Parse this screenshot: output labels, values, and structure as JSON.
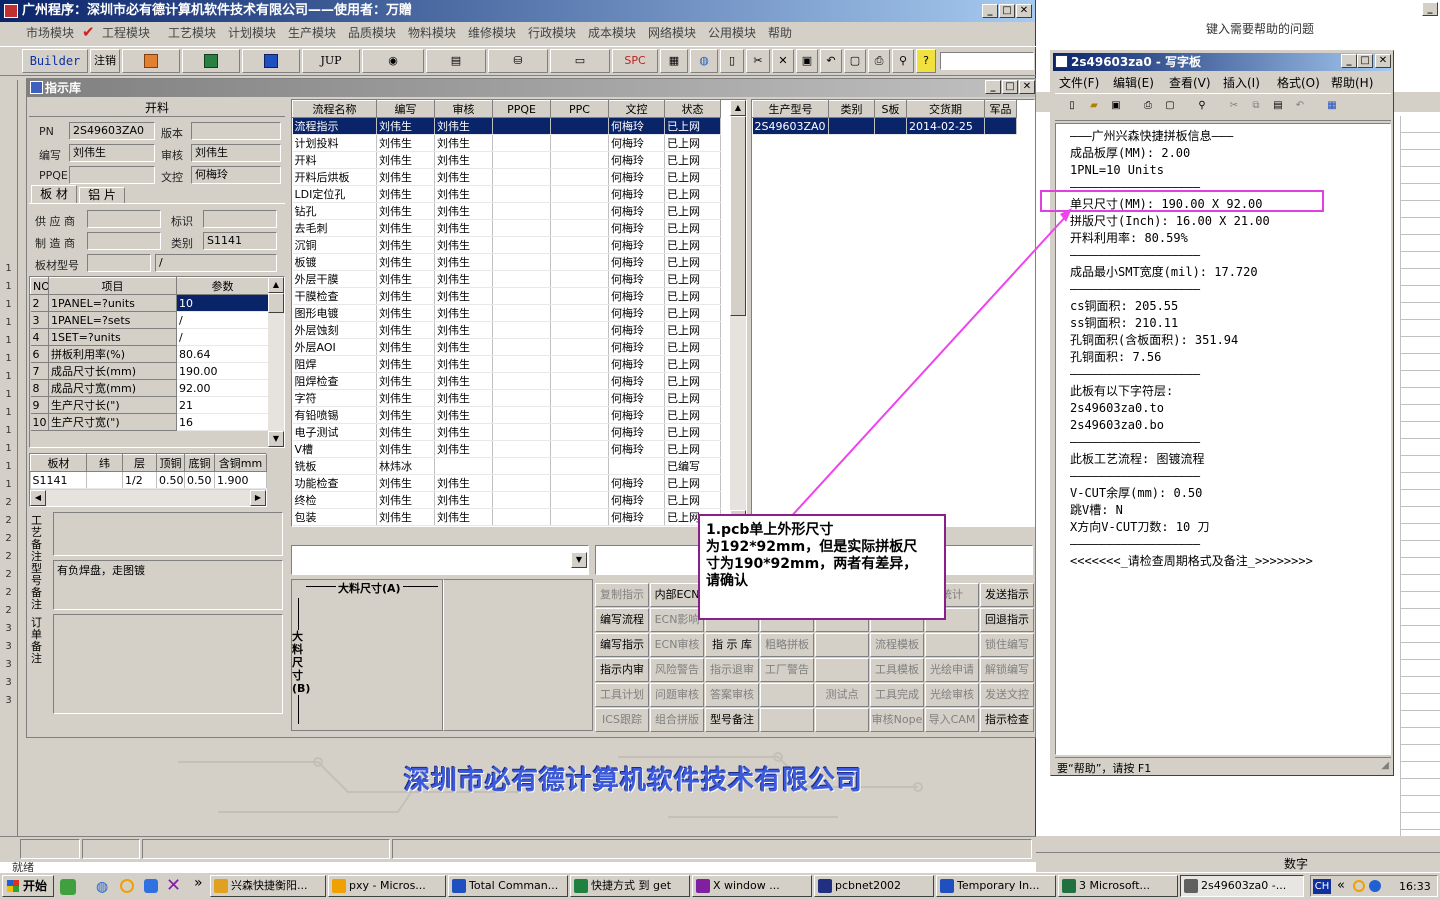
{
  "main_window": {
    "title": "广州程序：深圳市必有德计算机软件技术有限公司——使用者：万贈",
    "menu": [
      "市场模块",
      "工程模块",
      "工艺模块",
      "计划模块",
      "生产模块",
      "品质模块",
      "物料模块",
      "维修模块",
      "行政模块",
      "成本模块",
      "网络模块",
      "公用模块",
      "帮助"
    ],
    "toolbar": {
      "builder": "Builder",
      "logout": "注销",
      "jup": "JUP",
      "spc": "SPC"
    },
    "company_banner": "深圳市必有德计算机软件技术有限公司",
    "status_left": "就绪"
  },
  "help_box": {
    "placeholder": "键入需要帮助的问题"
  },
  "zhishi": {
    "title": "指示库",
    "section_title": "开料",
    "labels": {
      "pn": "PN",
      "version": "版本",
      "bianxie": "编写",
      "shenhe": "审核",
      "ppqe": "PPQE",
      "wenkong": "文控",
      "supplier": "供 应 商",
      "biaoshi": "标识",
      "maker": "制 造 商",
      "leibie": "类别",
      "board_model": "板材型号"
    },
    "values": {
      "pn": "2S49603ZA0",
      "version": "",
      "bianxie": "刘伟生",
      "shenhe": "刘伟生",
      "ppqe": "",
      "wenkong": "何梅玲",
      "supplier": "",
      "biaoshi": "",
      "maker": "",
      "leibie": "S1141",
      "board_model": "",
      "board_model2": "/"
    },
    "tabs": [
      "板 材",
      "铝 片"
    ],
    "param_headers": [
      "NO",
      "项目",
      "参数"
    ],
    "params": [
      [
        "2",
        "1PANEL=?units",
        "10"
      ],
      [
        "3",
        "1PANEL=?sets",
        "/"
      ],
      [
        "4",
        "1SET=?units",
        "/"
      ],
      [
        "6",
        "拼板利用率(%)",
        "80.64"
      ],
      [
        "7",
        "成品尺寸长(mm)",
        "190.00"
      ],
      [
        "8",
        "成品尺寸宽(mm)",
        "92.00"
      ],
      [
        "9",
        "生产尺寸长(\")",
        "21"
      ],
      [
        "10",
        "生产尺寸宽(\")",
        "16"
      ]
    ],
    "mat_headers": [
      "板材",
      "纬",
      "层",
      "顶铜",
      "底铜",
      "含铜mm"
    ],
    "mat_row": [
      "S1141",
      "",
      "1/2",
      "0.50",
      "0.50",
      "1.900"
    ],
    "notes": [
      {
        "label": "工艺备注",
        "text": ""
      },
      {
        "label": "型号备注",
        "text": "有负焊盘，走图镀"
      },
      {
        "label": "订单备注",
        "text": ""
      }
    ],
    "flow_headers": [
      "流程名称",
      "编写",
      "审核",
      "PPQE",
      "PPC",
      "文控",
      "状态"
    ],
    "flows": [
      [
        "流程指示",
        "刘伟生",
        "刘伟生",
        "",
        "",
        "何梅玲",
        "已上网"
      ],
      [
        "计划投料",
        "刘伟生",
        "刘伟生",
        "",
        "",
        "何梅玲",
        "已上网"
      ],
      [
        "开料",
        "刘伟生",
        "刘伟生",
        "",
        "",
        "何梅玲",
        "已上网"
      ],
      [
        "开料后烘板",
        "刘伟生",
        "刘伟生",
        "",
        "",
        "何梅玲",
        "已上网"
      ],
      [
        "LDI定位孔",
        "刘伟生",
        "刘伟生",
        "",
        "",
        "何梅玲",
        "已上网"
      ],
      [
        "钻孔",
        "刘伟生",
        "刘伟生",
        "",
        "",
        "何梅玲",
        "已上网"
      ],
      [
        "去毛刺",
        "刘伟生",
        "刘伟生",
        "",
        "",
        "何梅玲",
        "已上网"
      ],
      [
        "沉铜",
        "刘伟生",
        "刘伟生",
        "",
        "",
        "何梅玲",
        "已上网"
      ],
      [
        "板镀",
        "刘伟生",
        "刘伟生",
        "",
        "",
        "何梅玲",
        "已上网"
      ],
      [
        "外层干膜",
        "刘伟生",
        "刘伟生",
        "",
        "",
        "何梅玲",
        "已上网"
      ],
      [
        "干膜检查",
        "刘伟生",
        "刘伟生",
        "",
        "",
        "何梅玲",
        "已上网"
      ],
      [
        "图形电镀",
        "刘伟生",
        "刘伟生",
        "",
        "",
        "何梅玲",
        "已上网"
      ],
      [
        "外层蚀刻",
        "刘伟生",
        "刘伟生",
        "",
        "",
        "何梅玲",
        "已上网"
      ],
      [
        "外层AOI",
        "刘伟生",
        "刘伟生",
        "",
        "",
        "何梅玲",
        "已上网"
      ],
      [
        "阻焊",
        "刘伟生",
        "刘伟生",
        "",
        "",
        "何梅玲",
        "已上网"
      ],
      [
        "阻焊检查",
        "刘伟生",
        "刘伟生",
        "",
        "",
        "何梅玲",
        "已上网"
      ],
      [
        "字符",
        "刘伟生",
        "刘伟生",
        "",
        "",
        "何梅玲",
        "已上网"
      ],
      [
        "有铅喷锡",
        "刘伟生",
        "刘伟生",
        "",
        "",
        "何梅玲",
        "已上网"
      ],
      [
        "电子测试",
        "刘伟生",
        "刘伟生",
        "",
        "",
        "何梅玲",
        "已上网"
      ],
      [
        "V槽",
        "刘伟生",
        "刘伟生",
        "",
        "",
        "何梅玲",
        "已上网"
      ],
      [
        "铣板",
        "林炜冰",
        "",
        "",
        "",
        "",
        "已编写"
      ],
      [
        "功能检查",
        "刘伟生",
        "刘伟生",
        "",
        "",
        "何梅玲",
        "已上网"
      ],
      [
        "终检",
        "刘伟生",
        "刘伟生",
        "",
        "",
        "何梅玲",
        "已上网"
      ],
      [
        "包装",
        "刘伟生",
        "刘伟生",
        "",
        "",
        "何梅玲",
        "已上网"
      ]
    ],
    "prod_headers": [
      "生产型号",
      "类别",
      "S板",
      "交货期",
      "军品"
    ],
    "prod_row": [
      "2S49603ZA0",
      "",
      "",
      "2014-02-25",
      ""
    ],
    "dim_a": "大料尺寸(A)",
    "dim_b": "大料尺寸(B)",
    "buttons": [
      [
        "复制指示",
        "内部ECN",
        "",
        "",
        "",
        "",
        "统计",
        "发送指示"
      ],
      [
        "编写流程",
        "ECN影响",
        "",
        "",
        "",
        "",
        "",
        "回退指示"
      ],
      [
        "编写指示",
        "ECN审核",
        "指 示 库",
        "粗略拼板",
        "",
        "流程模板",
        "",
        "锁住编写"
      ],
      [
        "指示内审",
        "风险警告",
        "指示退审",
        "工厂警告",
        "",
        "工具模板",
        "光绘申请",
        "解锁编写"
      ],
      [
        "工具计划",
        "问题审核",
        "答案审核",
        "",
        "测试点",
        "工具完成",
        "光绘审核",
        "发送文控"
      ],
      [
        "ICS跟踪",
        "组合拼版",
        "型号备注",
        "",
        "",
        "审核Nope",
        "导入CAM",
        "指示检查"
      ]
    ],
    "buttons_enabled": [
      [
        false,
        true,
        false,
        false,
        false,
        false,
        false,
        true
      ],
      [
        true,
        false,
        false,
        false,
        false,
        false,
        false,
        true
      ],
      [
        true,
        false,
        true,
        false,
        false,
        false,
        false,
        false
      ],
      [
        true,
        false,
        false,
        false,
        false,
        false,
        false,
        false
      ],
      [
        false,
        false,
        false,
        false,
        false,
        false,
        false,
        false
      ],
      [
        false,
        false,
        true,
        false,
        false,
        false,
        false,
        true
      ]
    ]
  },
  "callout": {
    "lines": [
      "1.pcb单上外形尺寸",
      "为192*92mm，但是实际拼板尺",
      "寸为190*92mm，两者有差异，",
      "请确认"
    ]
  },
  "wordpad": {
    "title": "2s49603za0 - 写字板",
    "menu": [
      "文件(F)",
      "编辑(E)",
      "查看(V)",
      "插入(I)",
      "格式(O)",
      "帮助(H)"
    ],
    "lines": [
      "———广州兴森快捷拼板信息———",
      "成品板厚(MM): 2.00",
      "1PNL=10 Units",
      "——————————————————",
      "单只尺寸(MM): 190.00 X 92.00",
      "拼版尺寸(Inch): 16.00 X 21.00",
      "开料利用率: 80.59%",
      "——————————————————",
      "成品最小SMT宽度(mil): 17.720",
      "——————————————————",
      "cs铜面积: 205.55",
      "ss铜面积: 210.11",
      "孔铜面积(含板面积): 351.94",
      "孔铜面积: 7.56",
      "——————————————————",
      "此板有以下字符层:",
      "2s49603za0.to",
      "2s49603za0.bo",
      "——————————————————",
      "此板工艺流程: 图镀流程",
      "——————————————————",
      "V-CUT余厚(mm): 0.50",
      "跳V槽: N",
      "X方向V-CUT刀数: 10 刀",
      "——————————————————",
      "<<<<<<<_请检查周期格式及备注_>>>>>>>>"
    ],
    "status": "要“帮助”，请按 F1"
  },
  "excel_status": "数字",
  "taskbar": {
    "start": "开始",
    "items": [
      "兴森快捷衡阳...",
      "pxy - Micros...",
      "Total Comman...",
      "快捷方式 到 get",
      "X window ...",
      "pcbnet2002",
      "Temporary In...",
      "3 Microsoft...",
      "2s49603za0 -..."
    ],
    "lang": "CH",
    "clock": "16:33"
  },
  "colors": {
    "titlebar": "#0a246a",
    "selection": "#0a246a",
    "highlight": "#e040e0",
    "banner": "#3c5adc"
  }
}
